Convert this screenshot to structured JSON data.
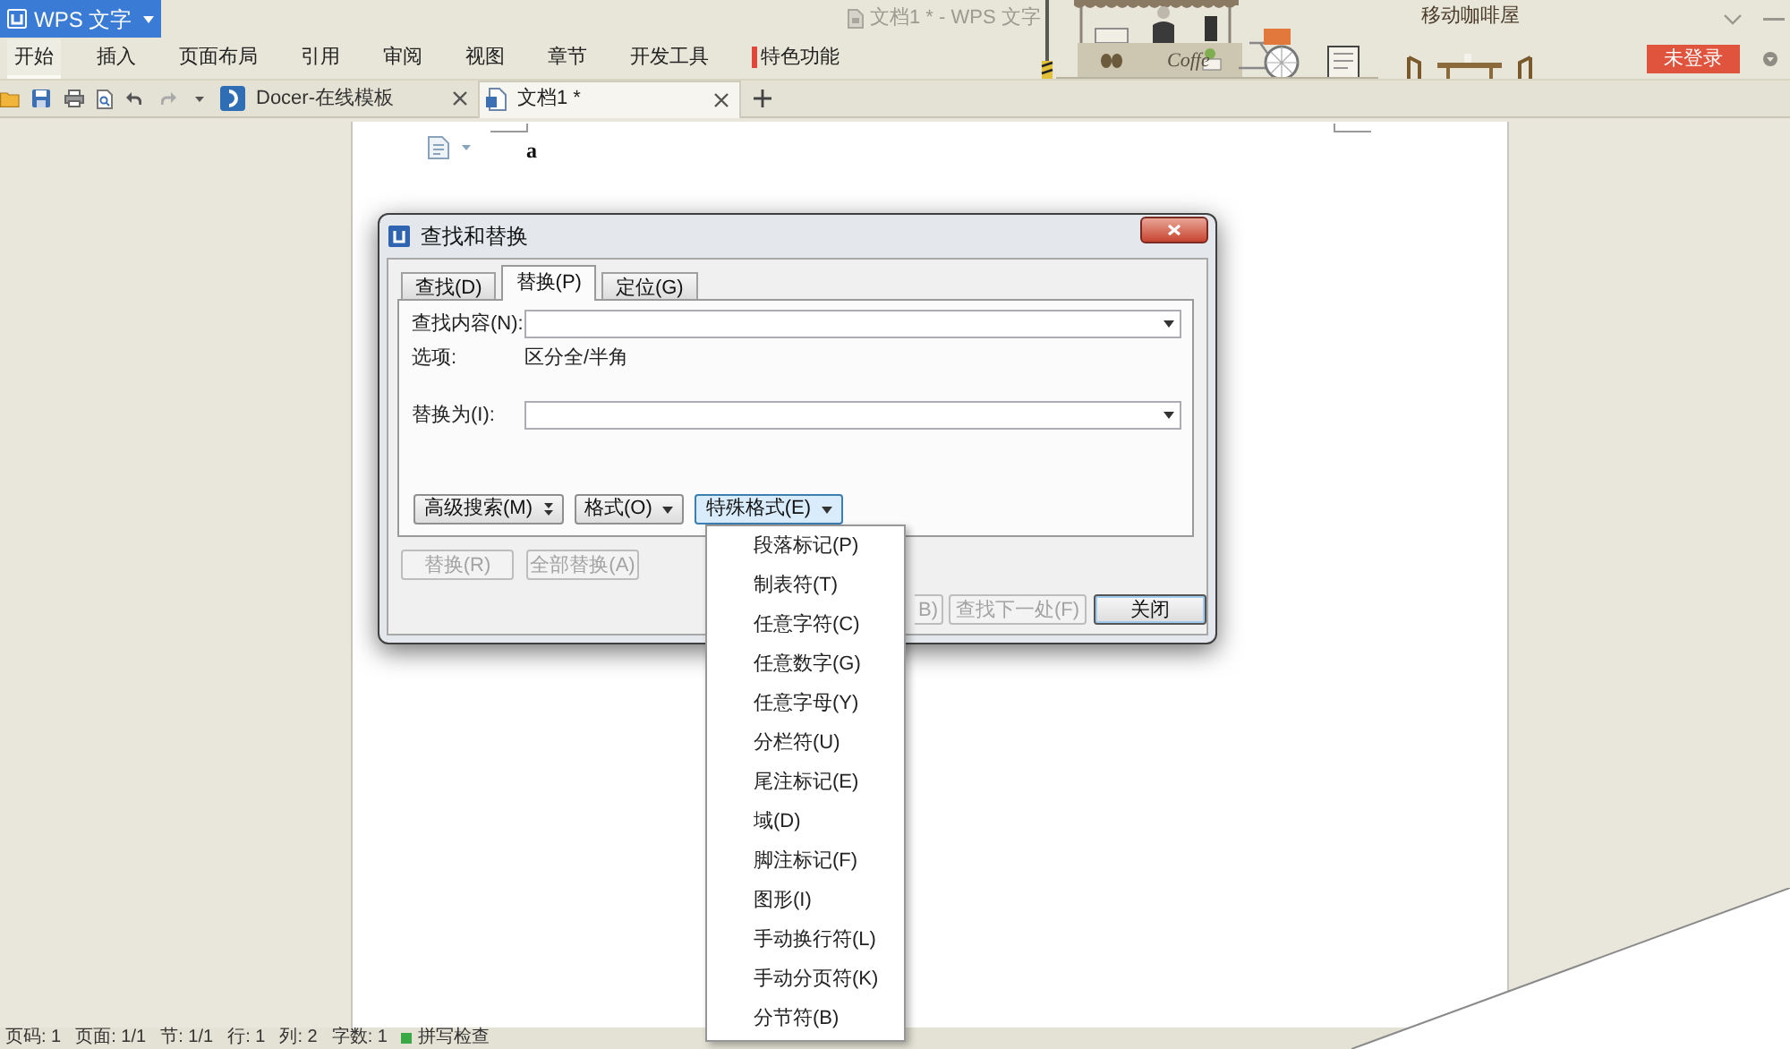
{
  "app_menu": {
    "label": "WPS 文字"
  },
  "window": {
    "title": "文档1 * - WPS 文字"
  },
  "banner": {
    "cart_text": "Coffe",
    "caption": "移动咖啡屋"
  },
  "ribbon_tabs": [
    {
      "label": "开始",
      "selected": true,
      "kind": "plain"
    },
    {
      "label": "插入",
      "selected": false,
      "kind": "plain"
    },
    {
      "label": "页面布局",
      "selected": false,
      "kind": "plain"
    },
    {
      "label": "引用",
      "selected": false,
      "kind": "plain"
    },
    {
      "label": "审阅",
      "selected": false,
      "kind": "plain"
    },
    {
      "label": "视图",
      "selected": false,
      "kind": "plain"
    },
    {
      "label": "章节",
      "selected": false,
      "kind": "plain"
    },
    {
      "label": "开发工具",
      "selected": false,
      "kind": "plain"
    },
    {
      "label": "特色功能",
      "selected": false,
      "kind": "featured"
    }
  ],
  "login_button": {
    "label": "未登录"
  },
  "doc_tabs": [
    {
      "label": "Docer-在线模板",
      "selected": false,
      "kind": "template"
    },
    {
      "label": "文档1 *",
      "selected": true,
      "kind": "document"
    }
  ],
  "document": {
    "text": "a"
  },
  "dialog": {
    "title": "查找和替换",
    "tabs": [
      {
        "label": "查找(D)",
        "selected": false
      },
      {
        "label": "替换(P)",
        "selected": true
      },
      {
        "label": "定位(G)",
        "selected": false
      }
    ],
    "find_label": "查找内容(N):",
    "options_label": "选项:",
    "options_value": "区分全/半角",
    "replace_label": "替换为(I):",
    "option_buttons": [
      {
        "label": "高级搜索(M)",
        "kind": "expand",
        "pressed": false
      },
      {
        "label": "格式(O)",
        "kind": "dropdown",
        "pressed": false
      },
      {
        "label": "特殊格式(E)",
        "kind": "dropdown",
        "pressed": true
      }
    ],
    "left_buttons": [
      {
        "label": "替换(R)",
        "disabled": true
      },
      {
        "label": "全部替换(A)",
        "disabled": true
      }
    ],
    "right_buttons": [
      {
        "label": "B)",
        "kind": "partial",
        "disabled": true
      },
      {
        "label": "查找下一处(F)",
        "kind": "normal",
        "disabled": true
      },
      {
        "label": "关闭",
        "kind": "default",
        "disabled": false
      }
    ]
  },
  "special_menu": {
    "items": [
      "段落标记(P)",
      "制表符(T)",
      "任意字符(C)",
      "任意数字(G)",
      "任意字母(Y)",
      "分栏符(U)",
      "尾注标记(E)",
      "域(D)",
      "脚注标记(F)",
      "图形(I)",
      "手动换行符(L)",
      "手动分页符(K)",
      "分节符(B)"
    ]
  },
  "status_bar": {
    "items": [
      "页码: 1",
      "页面: 1/1",
      "节: 1/1",
      "行: 1",
      "列: 2",
      "字数: 1"
    ],
    "spell_check": {
      "label": "拼写检查",
      "on": true
    }
  }
}
